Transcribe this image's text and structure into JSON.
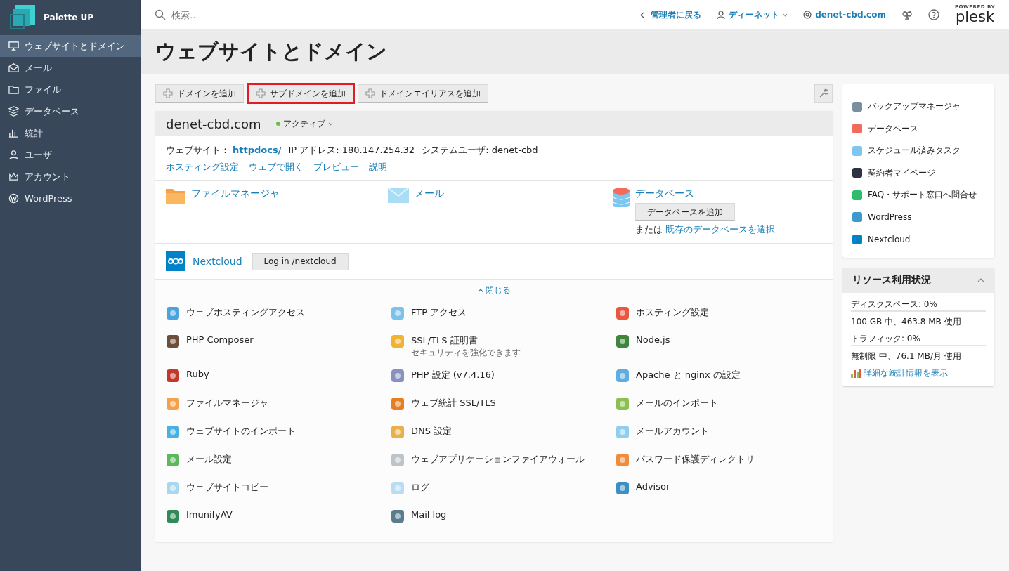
{
  "sidebar": {
    "brand": "Palette UP",
    "items": [
      {
        "label": "ウェブサイトとドメイン",
        "selected": true
      },
      {
        "label": "メール",
        "selected": false
      },
      {
        "label": "ファイル",
        "selected": false
      },
      {
        "label": "データベース",
        "selected": false
      },
      {
        "label": "統計",
        "selected": false
      },
      {
        "label": "ユーザ",
        "selected": false
      },
      {
        "label": "アカウント",
        "selected": false
      },
      {
        "label": "WordPress",
        "selected": false
      }
    ]
  },
  "topbar": {
    "search_placeholder": "検索...",
    "back_link": "管理者に戻る",
    "user": "ディーネット",
    "domain": "denet-cbd.com",
    "brand_caption": "POWERED BY",
    "brand": "plesk"
  },
  "page_title": "ウェブサイトとドメイン",
  "toolbar": [
    {
      "label": "ドメインを追加",
      "highlighted": false
    },
    {
      "label": "サブドメインを追加",
      "highlighted": true
    },
    {
      "label": "ドメインエイリアスを追加",
      "highlighted": false
    }
  ],
  "domain_card": {
    "name": "denet-cbd.com",
    "status": "アクティブ",
    "website_label": "ウェブサイト：",
    "website_link": "httpdocs/",
    "ip": "IP アドレス: 180.147.254.32",
    "system_user": "システムユーザ: denet-cbd",
    "links": [
      "ホスティング設定",
      "ウェブで開く",
      "プレビュー",
      "説明"
    ],
    "services": [
      {
        "kind": "files",
        "label": "ファイルマネージャ"
      },
      {
        "kind": "mail",
        "label": "メール"
      },
      {
        "kind": "database",
        "label": "データベース",
        "button": "データベースを追加",
        "alt_prefix": "または",
        "alt_link": "既存のデータベースを選択"
      }
    ],
    "nextcloud": {
      "label": "Nextcloud",
      "button": "Log in /nextcloud"
    },
    "collapse": "閉じる",
    "tools": [
      {
        "label": "ウェブホスティングアクセス"
      },
      {
        "label": "FTP アクセス"
      },
      {
        "label": "ホスティング設定"
      },
      {
        "label": "PHP Composer"
      },
      {
        "label": "SSL/TLS 証明書",
        "sub": "セキュリティを強化できます"
      },
      {
        "label": "Node.js"
      },
      {
        "label": "Ruby"
      },
      {
        "label": "PHP 設定 (v7.4.16)"
      },
      {
        "label": "Apache と nginx の設定"
      },
      {
        "label": "ファイルマネージャ"
      },
      {
        "label": "ウェブ統計 SSL/TLS"
      },
      {
        "label": "メールのインポート"
      },
      {
        "label": "ウェブサイトのインポート"
      },
      {
        "label": "DNS 設定"
      },
      {
        "label": "メールアカウント"
      },
      {
        "label": "メール設定"
      },
      {
        "label": "ウェブアプリケーションファイアウォール"
      },
      {
        "label": "パスワード保護ディレクトリ"
      },
      {
        "label": "ウェブサイトコピー"
      },
      {
        "label": "ログ"
      },
      {
        "label": "Advisor"
      },
      {
        "label": "ImunifyAV"
      },
      {
        "label": "Mail log"
      }
    ]
  },
  "quick_links": [
    "バックアップマネージャ",
    "データベース",
    "スケジュール済みタスク",
    "契約者マイページ",
    "FAQ・サポート窓口へ問合せ",
    "WordPress",
    "Nextcloud"
  ],
  "resources": {
    "title": "リソース利用状況",
    "expanded": true,
    "meters": [
      {
        "label": "ディスクスペース: 0%",
        "level": 0,
        "detail": "100 GB 中、463.8 MB 使用"
      },
      {
        "label": "トラフィック: 0%",
        "level": 0,
        "detail": "無制限 中、76.1 MB/月 使用"
      }
    ],
    "stats_link": "詳細な統計情報を表示"
  }
}
